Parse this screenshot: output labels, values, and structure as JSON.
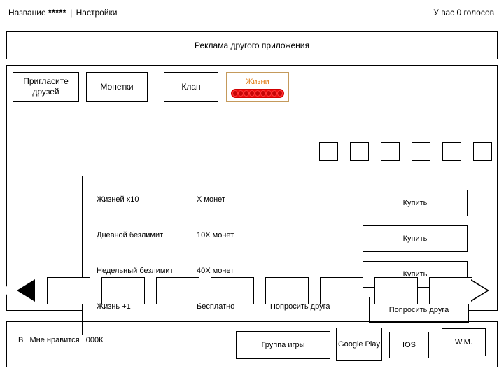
{
  "titlebar": {
    "app_name": "Название",
    "stars": "*****",
    "separator": "|",
    "settings_label": "Настройки",
    "votes_text": "У вас 0 голосов"
  },
  "ad_banner": {
    "text": "Реклама другого приложения"
  },
  "tabs": [
    {
      "id": "invite",
      "label": "Пригласите друзей"
    },
    {
      "id": "coins",
      "label": "Монетки"
    },
    {
      "id": "clan",
      "label": "Клан"
    },
    {
      "id": "lives",
      "label": "Жизни",
      "active": true,
      "border_color": "#c49a5c",
      "text_color": "#e2801c",
      "bar_color": "#f01010",
      "segments": 9
    }
  ],
  "slot_squares": [
    {
      "id": "slot-1"
    },
    {
      "id": "slot-2"
    },
    {
      "id": "slot-3"
    },
    {
      "id": "slot-4"
    },
    {
      "id": "slot-5"
    },
    {
      "id": "slot-6"
    }
  ],
  "offers": [
    {
      "name": "Жизней х10",
      "price": "Х монет",
      "extra": "",
      "button": "Купить"
    },
    {
      "name": "Дневной безлимит",
      "price": "10Х монет",
      "extra": "",
      "button": "Купить"
    },
    {
      "name": "Недельный безлимит",
      "price": "40Х монет",
      "extra": "",
      "button": "Купить"
    },
    {
      "name": "Жизнь +1",
      "price": "Бесплатно",
      "extra": "Попросить друга",
      "button": "Попросить друга"
    }
  ],
  "carousel": {
    "prev_icon": "triangle-left-icon",
    "next_icon": "triangle-right-icon",
    "cells": 8
  },
  "footer": {
    "like_prefix": "В",
    "like_label": "Мне нравится",
    "like_count": "000К",
    "buttons": [
      {
        "id": "group",
        "label": "Группа игры"
      },
      {
        "id": "gplay",
        "label": "Google Play"
      },
      {
        "id": "ios",
        "label": "IOS"
      },
      {
        "id": "wm",
        "label": "W.M."
      }
    ]
  }
}
